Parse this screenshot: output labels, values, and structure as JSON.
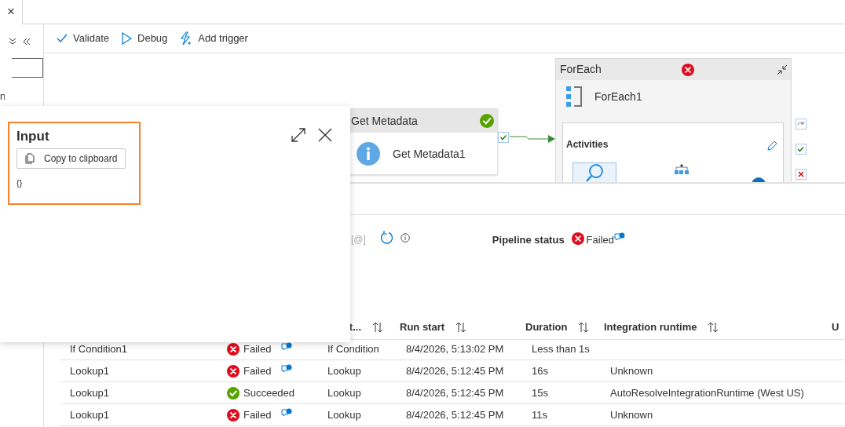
{
  "tab": {
    "close": "×"
  },
  "sidebar": {
    "partial_text": "n"
  },
  "toolbar": [
    {
      "label": "Validate",
      "kind": "validate"
    },
    {
      "label": "Debug",
      "kind": "debug"
    },
    {
      "label": "Add trigger",
      "kind": "trigger"
    }
  ],
  "canvas": {
    "activity": {
      "title": "Get Metadata",
      "name": "Get Metadata1",
      "failed": false
    },
    "foreach": {
      "title": "ForEach",
      "failed": true,
      "name": "ForEach1",
      "activities_label": "Activities"
    }
  },
  "input_panel": {
    "title": "Input",
    "copy_button": "Copy to clipboard",
    "content": "{}"
  },
  "monitor": {
    "toolbar_text": "[@]",
    "pipeline_status": {
      "label": "Pipeline status",
      "failed": true,
      "text": "Failed"
    }
  },
  "table": {
    "columns": [
      {
        "label": "t...",
        "sortable": true
      },
      {
        "label": "Run start",
        "sortable": true
      },
      {
        "label": "Duration",
        "sortable": true
      },
      {
        "label": "Integration runtime",
        "sortable": true
      },
      {
        "label": "U",
        "sortable": false
      }
    ],
    "rows": [
      {
        "name": "If Condition1",
        "failed": true,
        "status_text": "Failed",
        "has_comment": true,
        "type": "If Condition",
        "run_start": "8/4/2026, 5:13:02 PM",
        "duration": "Less than 1s"
      },
      {
        "name": "Lookup1",
        "failed": true,
        "status_text": "Failed",
        "has_comment": true,
        "type": "Lookup",
        "run_start": "8/4/2026, 5:12:45 PM",
        "duration": "16s",
        "runtime": "Unknown"
      },
      {
        "name": "Lookup1",
        "failed": false,
        "status_text": "Succeeded",
        "has_comment": false,
        "type": "Lookup",
        "run_start": "8/4/2026, 5:12:45 PM",
        "duration": "15s",
        "runtime": "AutoResolveIntegrationRuntime (West US)"
      },
      {
        "name": "Lookup1",
        "failed": true,
        "status_text": "Failed",
        "has_comment": true,
        "type": "Lookup",
        "run_start": "8/4/2026, 5:12:45 PM",
        "duration": "11s",
        "runtime": "Unknown"
      }
    ]
  }
}
